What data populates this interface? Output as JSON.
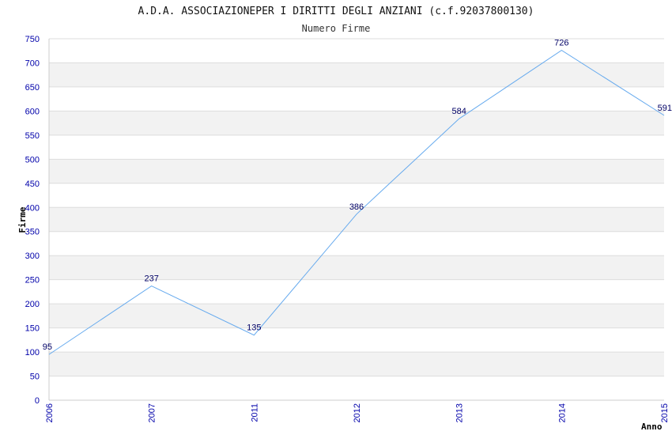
{
  "chart_data": {
    "type": "line",
    "title": "A.D.A. ASSOCIAZIONEPER I DIRITTI DEGLI ANZIANI (c.f.92037800130)",
    "subtitle": "Numero Firme",
    "xlabel": "Anno",
    "ylabel": "Firme",
    "categories": [
      "2006",
      "2007",
      "2011",
      "2012",
      "2013",
      "2014",
      "2015"
    ],
    "values": [
      95,
      237,
      135,
      386,
      584,
      726,
      591
    ],
    "ylim": [
      0,
      750
    ],
    "ytick_step": 50,
    "grid": true,
    "legend": "none",
    "colors": {
      "line": "#66aaee",
      "band": "#f2f2f2",
      "grid": "#dddddd",
      "tick_text": "#0000aa",
      "data_label": "#000066"
    }
  }
}
